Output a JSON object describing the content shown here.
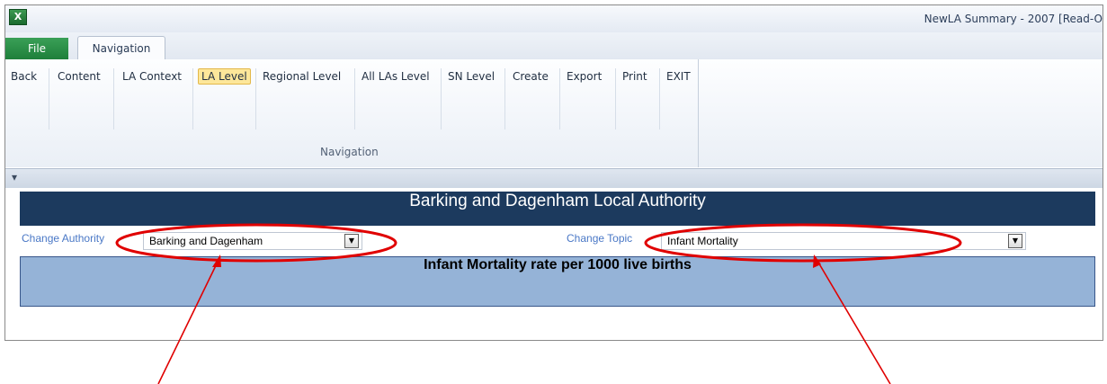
{
  "window": {
    "title": "NewLA Summary - 2007  [Read-O"
  },
  "tabs": {
    "file": "File",
    "navigation": "Navigation"
  },
  "ribbon": {
    "buttons": [
      "Back",
      "Content",
      "LA Context",
      "LA Level",
      "Regional Level",
      "All LAs Level",
      "SN Level",
      "Create",
      "Export",
      "Print",
      "EXIT"
    ],
    "active_button": "LA Level",
    "group_label": "Navigation"
  },
  "content": {
    "banner_title": "Barking and Dagenham Local Authority",
    "change_authority_label": "Change Authority",
    "authority_value": "Barking and Dagenham",
    "change_topic_label": "Change Topic",
    "topic_value": "Infant Mortality",
    "subtitle": "Infant Mortality rate per 1000 live births"
  },
  "colors": {
    "banner": "#1c3a5e",
    "subbanner": "#95b3d7",
    "annotation": "#e00000",
    "link_label": "#4a78c6",
    "active_ribbon": "#fde79a"
  },
  "icons": {
    "app": "excel-icon",
    "qat": "customize-qat-icon",
    "dropdown": "dropdown-arrow-icon"
  }
}
